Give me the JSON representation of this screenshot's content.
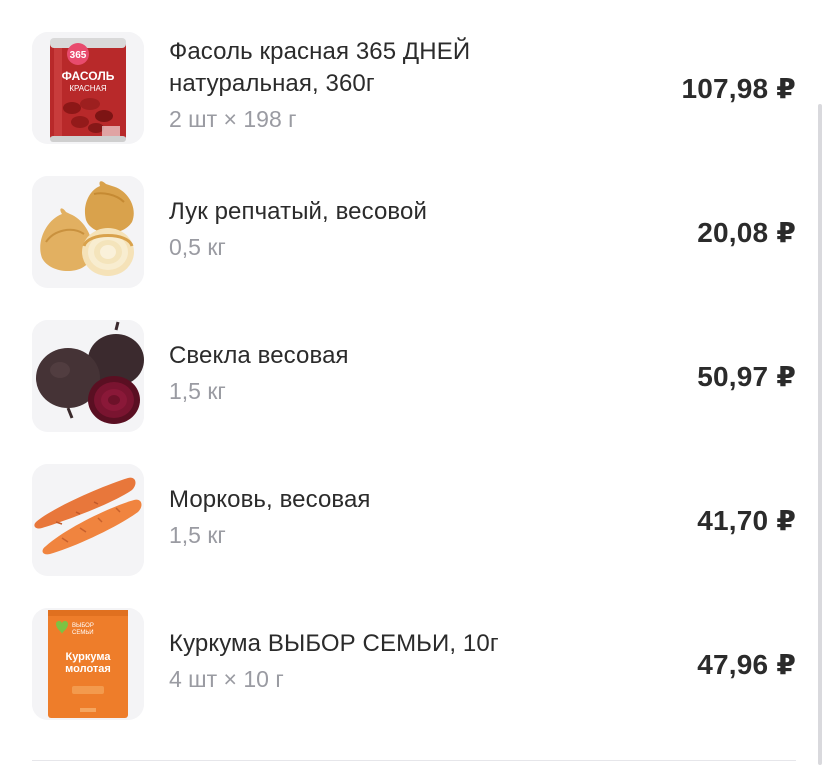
{
  "cart": {
    "items": [
      {
        "name": "Фасоль красная 365 ДНЕЙ натуральная, 360г",
        "quantity": "2 шт × 198 г",
        "price": "107,98 ₽",
        "image_icon": "red-beans-can-icon",
        "image_text": {
          "brand": "365",
          "product": "ФАСОЛЬ",
          "variant": "КРАСНАЯ"
        }
      },
      {
        "name": "Лук репчатый, весовой",
        "quantity": "0,5 кг",
        "price": "20,08 ₽",
        "image_icon": "onion-icon"
      },
      {
        "name": "Свекла весовая",
        "quantity": "1,5 кг",
        "price": "50,97 ₽",
        "image_icon": "beetroot-icon"
      },
      {
        "name": "Морковь, весовая",
        "quantity": "1,5 кг",
        "price": "41,70 ₽",
        "image_icon": "carrot-icon"
      },
      {
        "name": "Куркума ВЫБОР СЕМЬИ, 10г",
        "quantity": "4 шт × 10 г",
        "price": "47,96 ₽",
        "image_icon": "turmeric-pack-icon",
        "image_text": {
          "brand": "ВЫБОР СЕМЬИ",
          "product": "Куркума молотая"
        }
      }
    ]
  },
  "colors": {
    "text_primary": "#2b2b2b",
    "text_secondary": "#9a9ba2",
    "thumb_bg": "#f4f4f6",
    "divider": "#e6e6ea"
  }
}
